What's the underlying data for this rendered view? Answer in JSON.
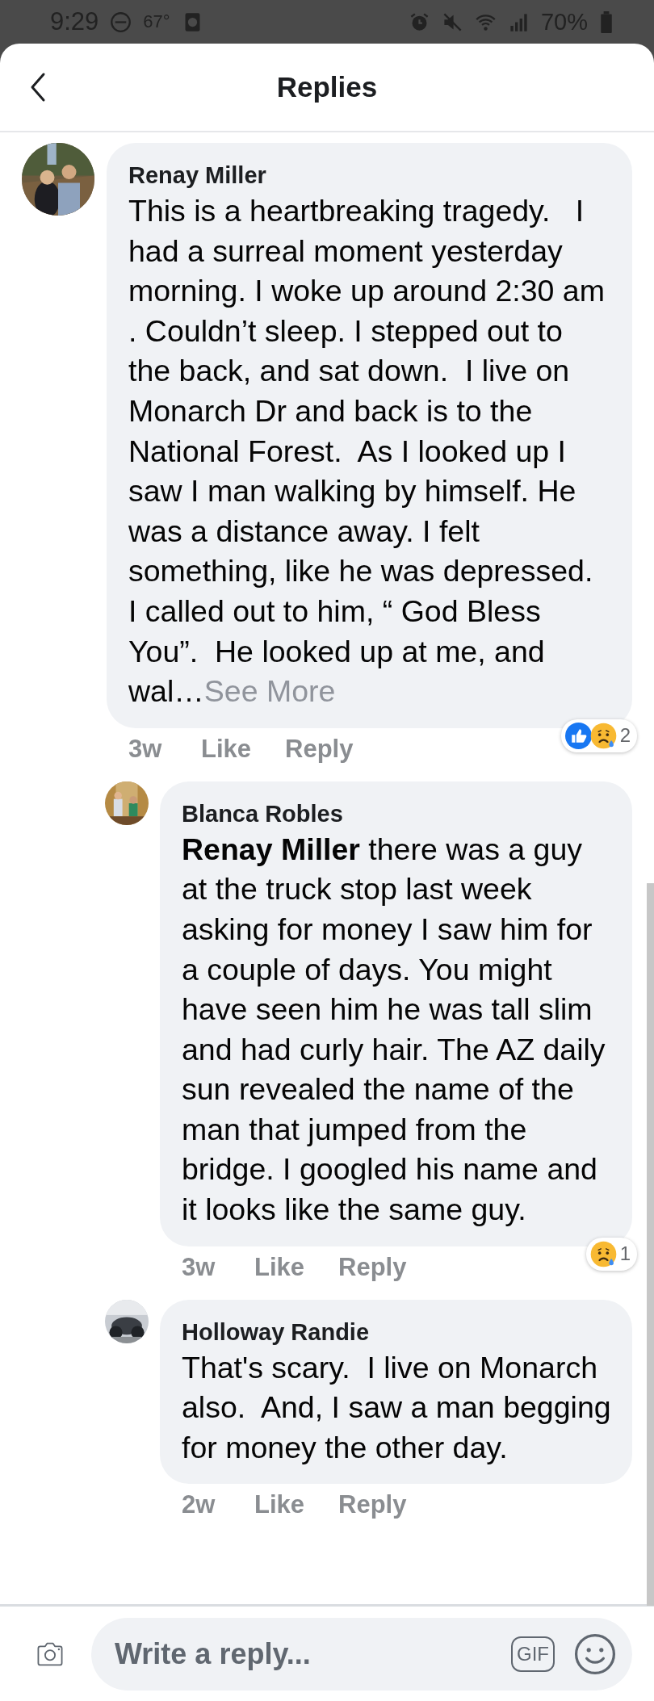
{
  "status_bar": {
    "time": "9:29",
    "temperature": "67°",
    "battery": "70%"
  },
  "header": {
    "title": "Replies"
  },
  "comments": [
    {
      "author": "Renay Miller",
      "text": "This is a heartbreaking tragedy.   I had a surreal moment yesterday morning. I woke up around 2:30 am . Couldn’t sleep. I stepped out to the back, and sat down.  I live on Monarch Dr and back is to the National Forest.  As I looked up I saw I man walking by himself. He was a distance away. I felt something, like he was depressed.  I called out to him, “ God Bless You”.  He looked up at me, and wal…",
      "see_more": "See More",
      "time": "3w",
      "like": "Like",
      "reply": "Reply",
      "reactions": [
        {
          "kind": "like"
        },
        {
          "kind": "sad"
        }
      ],
      "reaction_count": "2",
      "replies": [
        {
          "author": "Blanca Robles",
          "text": "**Renay Miller** there was a guy at the truck stop last week asking for money I saw him for a couple of days. You might have seen him he was tall slim and had curly hair. The AZ daily sun revealed the name of the man that jumped from the bridge. I googled his name and it looks like the same guy.",
          "time": "3w",
          "like": "Like",
          "reply": "Reply",
          "reactions": [
            {
              "kind": "sad"
            }
          ],
          "reaction_count": "1"
        },
        {
          "author": "Holloway Randie",
          "text": "That's scary.  I live on Monarch also.  And, I saw a man begging for money the other day.",
          "time": "2w",
          "like": "Like",
          "reply": "Reply"
        }
      ]
    }
  ],
  "composer": {
    "placeholder": "Write a reply...",
    "gif": "GIF"
  }
}
